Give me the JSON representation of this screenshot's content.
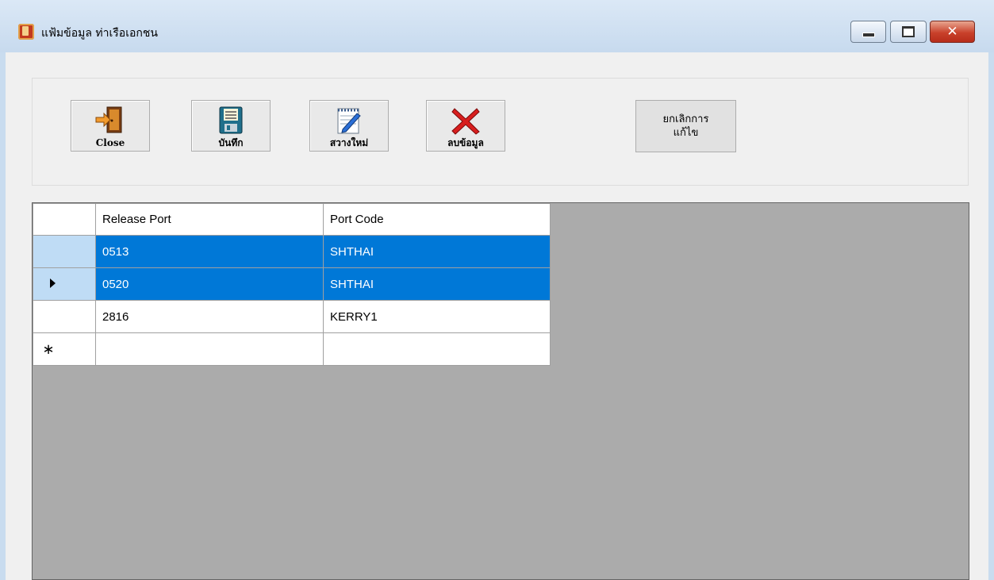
{
  "window": {
    "title": "แฟ้มข้อมูล ท่าเรือเอกชน",
    "controls": {
      "minimize_icon": "minimize-icon",
      "maximize_icon": "maximize-icon",
      "close_glyph": "✕"
    }
  },
  "toolbar": {
    "close_label": "Close",
    "save_label": "บันทึก",
    "new_label": "สวางใหม่",
    "delete_label": "ลบข้อมูล",
    "cancel_edit_label": "ยกเลิกการ\nแก้ไข"
  },
  "grid": {
    "columns": [
      "Release Port",
      "Port Code"
    ],
    "rows": [
      {
        "release_port": "0513",
        "port_code": "SHTHAI",
        "selected": true
      },
      {
        "release_port": "0520",
        "port_code": "SHTHAI",
        "selected": true,
        "current": true
      },
      {
        "release_port": "2816",
        "port_code": "KERRY1",
        "selected": false
      }
    ],
    "new_row_marker": "∗"
  },
  "colors": {
    "selection": "#0078d7",
    "grid_background": "#ababab",
    "close_button": "#c9412b"
  }
}
